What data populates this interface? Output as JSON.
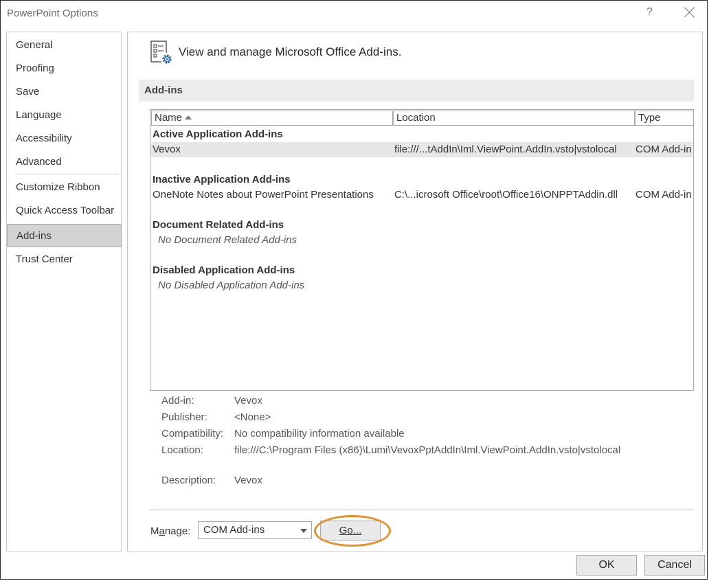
{
  "window": {
    "title": "PowerPoint Options",
    "help": "?"
  },
  "sidebar": {
    "items": [
      {
        "label": "General"
      },
      {
        "label": "Proofing"
      },
      {
        "label": "Save"
      },
      {
        "label": "Language"
      },
      {
        "label": "Accessibility"
      },
      {
        "label": "Advanced"
      },
      {
        "label": "Customize Ribbon"
      },
      {
        "label": "Quick Access Toolbar"
      },
      {
        "label": "Add-ins",
        "selected": true
      },
      {
        "label": "Trust Center"
      }
    ]
  },
  "header": {
    "text": "View and manage Microsoft Office Add-ins.",
    "icon": "addins-gear-icon"
  },
  "section": {
    "title": "Add-ins"
  },
  "table": {
    "columns": [
      "Name",
      "Location",
      "Type"
    ],
    "sort": "Name ascending",
    "groups": [
      {
        "title": "Active Application Add-ins",
        "rows": [
          {
            "name": "Vevox",
            "location": "file:///...tAddIn\\Iml.ViewPoint.AddIn.vsto|vstolocal",
            "type": "COM Add-in",
            "selected": true
          }
        ]
      },
      {
        "title": "Inactive Application Add-ins",
        "rows": [
          {
            "name": "OneNote Notes about PowerPoint Presentations",
            "location": "C:\\...icrosoft Office\\root\\Office16\\ONPPTAddin.dll",
            "type": "COM Add-in"
          }
        ]
      },
      {
        "title": "Document Related Add-ins",
        "empty": "No Document Related Add-ins"
      },
      {
        "title": "Disabled Application Add-ins",
        "empty": "No Disabled Application Add-ins"
      }
    ]
  },
  "details": {
    "addin_label": "Add-in:",
    "addin": "Vevox",
    "publisher_label": "Publisher:",
    "publisher": "<None>",
    "compat_label": "Compatibility:",
    "compat": "No compatibility information available",
    "location_label": "Location:",
    "location": "file:///C:\\Program Files (x86)\\Lumi\\VevoxPptAddIn\\Iml.ViewPoint.AddIn.vsto|vstolocal",
    "description_label": "Description:",
    "description": "Vevox"
  },
  "manage": {
    "label_pre": "M",
    "label_u": "a",
    "label_post": "nage:",
    "selected": "COM Add-ins",
    "go_pre": "",
    "go_u": "G",
    "go_post": "o..."
  },
  "footer": {
    "ok": "OK",
    "cancel": "Cancel"
  },
  "colors": {
    "highlight": "#e8902c",
    "selection": "#d3d3d3"
  }
}
